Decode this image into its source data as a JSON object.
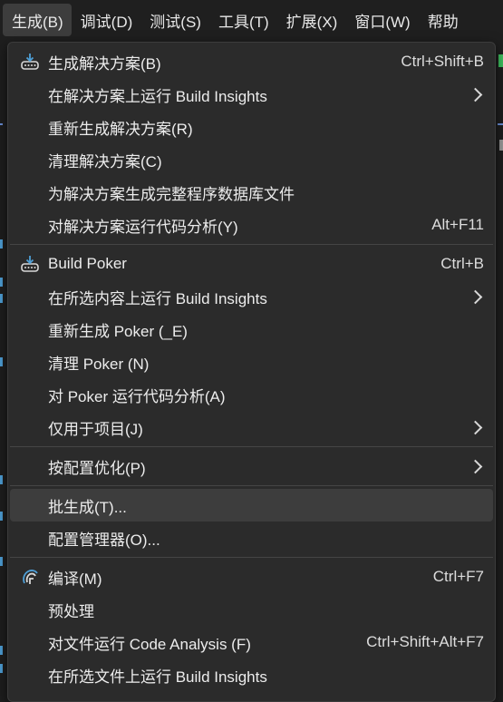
{
  "menubar": {
    "items": [
      "生成(B)",
      "调试(D)",
      "测试(S)",
      "工具(T)",
      "扩展(X)",
      "窗口(W)",
      "帮助"
    ]
  },
  "menu": {
    "build_solution": {
      "label": "生成解决方案(B)",
      "shortcut": "Ctrl+Shift+B",
      "icon": "build-icon"
    },
    "run_build_insights_solution": {
      "label": "在解决方案上运行 Build Insights"
    },
    "rebuild_solution": {
      "label": "重新生成解决方案(R)"
    },
    "clean_solution": {
      "label": "清理解决方案(C)"
    },
    "generate_program_database": {
      "label": "为解决方案生成完整程序数据库文件"
    },
    "run_code_analysis_solution": {
      "label": "对解决方案运行代码分析(Y)",
      "shortcut": "Alt+F11"
    },
    "build_poker": {
      "label": "Build Poker",
      "shortcut": "Ctrl+B",
      "icon": "build-icon"
    },
    "run_build_insights_selection": {
      "label": "在所选内容上运行 Build Insights"
    },
    "rebuild_poker": {
      "label": "重新生成 Poker (_E)"
    },
    "clean_poker": {
      "label": "清理 Poker (N)"
    },
    "run_code_analysis_poker": {
      "label": "对 Poker 运行代码分析(A)"
    },
    "project_only": {
      "label": "仅用于项目(J)"
    },
    "pgo": {
      "label": "按配置优化(P)"
    },
    "batch_build": {
      "label": "批生成(T)..."
    },
    "config_manager": {
      "label": "配置管理器(O)..."
    },
    "compile": {
      "label": "编译(M)",
      "shortcut": "Ctrl+F7",
      "icon": "compile-icon"
    },
    "preprocess": {
      "label": "预处理"
    },
    "run_code_analysis_file": {
      "label": "对文件运行 Code Analysis (F)",
      "shortcut": "Ctrl+Shift+Alt+F7"
    },
    "run_build_insights_files": {
      "label": "在所选文件上运行 Build Insights"
    }
  },
  "colors": {
    "menu_bg": "#2b2b2b",
    "highlight": "#3d3d3d",
    "accent_blue": "#4ea0d8"
  }
}
